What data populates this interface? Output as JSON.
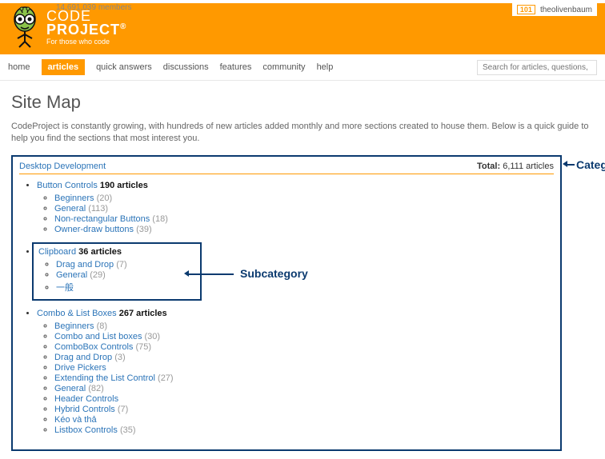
{
  "header": {
    "members": "14,691,039 members",
    "user_badge": "101",
    "username": "theolivenbaum",
    "logo_line1": "CODE",
    "logo_line2": "PROJECT",
    "logo_tag": "For those who code"
  },
  "nav": {
    "items": [
      "home",
      "articles",
      "quick answers",
      "discussions",
      "features",
      "community",
      "help"
    ],
    "active_index": 1,
    "search_placeholder": "Search for articles, questions, tips"
  },
  "page": {
    "title": "Site Map",
    "intro": "CodeProject is constantly growing, with hundreds of new articles added monthly and more sections created to house them. Below is a quick guide to help you find the sections that most interest you."
  },
  "category": {
    "name": "Desktop Development",
    "total_label": "Total:",
    "total_value": "6,111 articles"
  },
  "subcats": [
    {
      "name": "Button Controls",
      "count": "190 articles",
      "items": [
        {
          "name": "Beginners",
          "count": "(20)"
        },
        {
          "name": "General",
          "count": "(113)"
        },
        {
          "name": "Non-rectangular Buttons",
          "count": "(18)"
        },
        {
          "name": "Owner-draw buttons",
          "count": "(39)"
        }
      ]
    },
    {
      "name": "Clipboard",
      "count": "36 articles",
      "items": [
        {
          "name": "Drag and Drop",
          "count": "(7)"
        },
        {
          "name": "General",
          "count": "(29)"
        },
        {
          "name": "一般",
          "count": ""
        }
      ]
    },
    {
      "name": "Combo & List Boxes",
      "count": "267 articles",
      "items": [
        {
          "name": "Beginners",
          "count": "(8)"
        },
        {
          "name": "Combo and List boxes",
          "count": "(30)"
        },
        {
          "name": "ComboBox Controls",
          "count": "(75)"
        },
        {
          "name": "Drag and Drop",
          "count": "(3)"
        },
        {
          "name": "Drive Pickers",
          "count": ""
        },
        {
          "name": "Extending the List Control",
          "count": "(27)"
        },
        {
          "name": "General",
          "count": "(82)"
        },
        {
          "name": "Header Controls",
          "count": ""
        },
        {
          "name": "Hybrid Controls",
          "count": "(7)"
        },
        {
          "name": "Kéo và thả",
          "count": ""
        },
        {
          "name": "Listbox Controls",
          "count": "(35)"
        }
      ]
    }
  ],
  "annotations": {
    "category": "Category",
    "subcategory": "Subcategory"
  }
}
